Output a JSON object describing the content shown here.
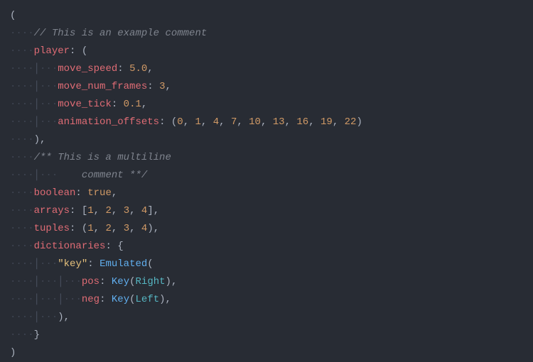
{
  "comment1": "// This is an example comment",
  "player": {
    "label": "player"
  },
  "move_speed": {
    "label": "move_speed",
    "value": "5.0"
  },
  "move_num_frames": {
    "label": "move_num_frames",
    "value": "3"
  },
  "move_tick": {
    "label": "move_tick",
    "value": "0.1"
  },
  "animation_offsets": {
    "label": "animation_offsets",
    "v0": "0",
    "v1": "1",
    "v2": "4",
    "v3": "7",
    "v4": "10",
    "v5": "13",
    "v6": "16",
    "v7": "19",
    "v8": "22"
  },
  "comment2a": "/** This is a multiline",
  "comment2b": "    comment **/",
  "boolean": {
    "label": "boolean",
    "value": "true"
  },
  "arrays": {
    "label": "arrays",
    "v0": "1",
    "v1": "2",
    "v2": "3",
    "v3": "4"
  },
  "tuples": {
    "label": "tuples",
    "v0": "1",
    "v1": "2",
    "v2": "3",
    "v3": "4"
  },
  "dictionaries": {
    "label": "dictionaries"
  },
  "dict": {
    "keyStr": "\"key\"",
    "emulated": "Emulated",
    "pos": {
      "label": "pos",
      "fn": "Key",
      "arg": "Right"
    },
    "neg": {
      "label": "neg",
      "fn": "Key",
      "arg": "Left"
    }
  },
  "punct": {
    "c": ",",
    "colon": ":",
    "lp": "(",
    "rp": ")",
    "lsq": "[",
    "rsq": "]",
    "lbr": "{",
    "rbr": "}",
    "cs": ", "
  }
}
